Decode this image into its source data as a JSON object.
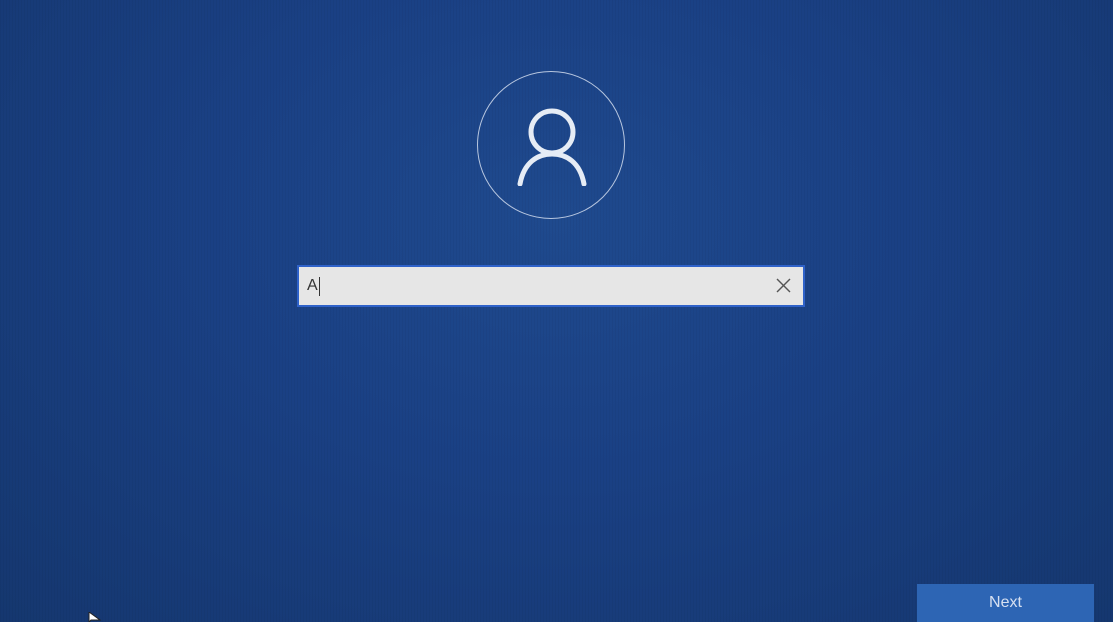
{
  "background_color": "#1a4084",
  "avatar": {
    "icon": "user-icon"
  },
  "username": {
    "value": "A",
    "clear_icon": "close-icon"
  },
  "next_button": {
    "label": "Next"
  },
  "accent_color": "#2f62c9"
}
